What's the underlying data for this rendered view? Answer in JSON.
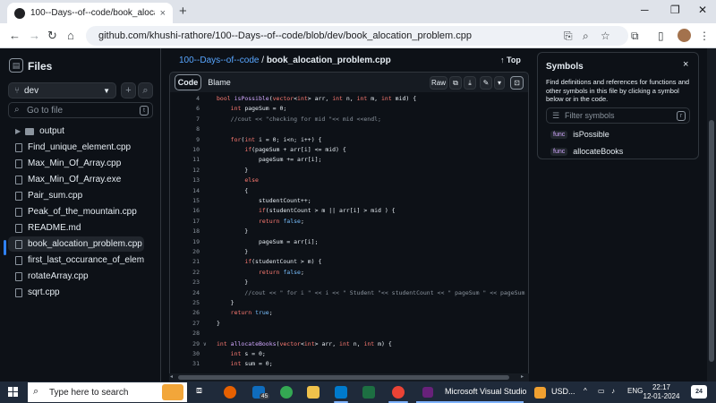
{
  "browser": {
    "tab_title": "100--Days--of--code/book_alocatio",
    "tab_close": "×",
    "new_tab": "+",
    "url": "github.com/khushi-rathore/100--Days--of--code/blob/dev/book_alocation_problem.cpp",
    "window_controls": {
      "minimize": "─",
      "restore": "❐",
      "close": "✕"
    }
  },
  "sidebar": {
    "title": "Files",
    "branch": "dev",
    "add_label": "+",
    "search_btn_label": "⌕",
    "goto_placeholder": "Go to file",
    "goto_key": "t",
    "items": [
      {
        "label": "output",
        "kind": "folder"
      },
      {
        "label": "Find_unique_element.cpp",
        "kind": "file"
      },
      {
        "label": "Max_Min_Of_Array.cpp",
        "kind": "file"
      },
      {
        "label": "Max_Min_Of_Array.exe",
        "kind": "file"
      },
      {
        "label": "Pair_sum.cpp",
        "kind": "file"
      },
      {
        "label": "Peak_of_the_mountain.cpp",
        "kind": "file"
      },
      {
        "label": "README.md",
        "kind": "file"
      },
      {
        "label": "book_alocation_problem.cpp",
        "kind": "file",
        "selected": true
      },
      {
        "label": "first_last_occurance_of_element.c...",
        "kind": "file"
      },
      {
        "label": "rotateArray.cpp",
        "kind": "file"
      },
      {
        "label": "sqrt.cpp",
        "kind": "file"
      }
    ]
  },
  "main": {
    "breadcrumb_repo": "100--Days--of--code",
    "breadcrumb_sep": " / ",
    "breadcrumb_file": "book_alocation_problem.cpp",
    "top_label": "Top",
    "tab_code": "Code",
    "tab_blame": "Blame",
    "raw_label": "Raw",
    "code_lines": [
      {
        "n": "4",
        "fold": false,
        "text": "bool isPossible(vector<int> arr, int n, int m, int mid) {"
      },
      {
        "n": "6",
        "fold": false,
        "text": "    int pageSum = 0;"
      },
      {
        "n": "7",
        "fold": false,
        "text": "    //cout << \"checking for mid \"<< mid <<endl;"
      },
      {
        "n": "8",
        "fold": false,
        "text": ""
      },
      {
        "n": "9",
        "fold": false,
        "text": "    for(int i = 0; i<n; i++) {"
      },
      {
        "n": "10",
        "fold": false,
        "text": "        if(pageSum + arr[i] <= mid) {"
      },
      {
        "n": "11",
        "fold": false,
        "text": "            pageSum += arr[i];"
      },
      {
        "n": "12",
        "fold": false,
        "text": "        }"
      },
      {
        "n": "13",
        "fold": false,
        "text": "        else"
      },
      {
        "n": "14",
        "fold": false,
        "text": "        {"
      },
      {
        "n": "15",
        "fold": false,
        "text": "            studentCount++;"
      },
      {
        "n": "16",
        "fold": false,
        "text": "            if(studentCount > m || arr[i] > mid ) {"
      },
      {
        "n": "17",
        "fold": false,
        "text": "            return false;"
      },
      {
        "n": "18",
        "fold": false,
        "text": "        }"
      },
      {
        "n": "19",
        "fold": false,
        "text": "            pageSum = arr[i];"
      },
      {
        "n": "20",
        "fold": false,
        "text": "        }"
      },
      {
        "n": "21",
        "fold": false,
        "text": "        if(studentCount > m) {"
      },
      {
        "n": "22",
        "fold": false,
        "text": "            return false;"
      },
      {
        "n": "23",
        "fold": false,
        "text": "        }"
      },
      {
        "n": "24",
        "fold": false,
        "text": "        //cout << \" for i \" << i << \" Student \"<< studentCount << \" pageSum \" << pageSum << endl;"
      },
      {
        "n": "25",
        "fold": false,
        "text": "    }"
      },
      {
        "n": "26",
        "fold": false,
        "text": "    return true;"
      },
      {
        "n": "27",
        "fold": false,
        "text": "}"
      },
      {
        "n": "28",
        "fold": false,
        "text": ""
      },
      {
        "n": "29",
        "fold": true,
        "text": "int allocateBooks(vector<int> arr, int n, int m) {"
      },
      {
        "n": "30",
        "fold": false,
        "text": "    int s = 0;"
      },
      {
        "n": "31",
        "fold": false,
        "text": "    int sum = 0;"
      }
    ]
  },
  "symbols": {
    "title": "Symbols",
    "close": "×",
    "description": "Find definitions and references for functions and other symbols in this file by clicking a symbol below or in the code.",
    "filter_placeholder": "Filter symbols",
    "filter_key": "r",
    "items": [
      {
        "badge": "func",
        "name": "isPossible"
      },
      {
        "badge": "func",
        "name": "allocateBooks"
      }
    ]
  },
  "taskbar": {
    "search_placeholder": "Type here to search",
    "mail_badge": "45",
    "active_app": "Microsoft Visual Studio",
    "usd": "USD...",
    "lang": "ENG",
    "time": "22:17",
    "date": "12-01-2024",
    "notifications": "24"
  },
  "colors": {
    "accent": "#2f81f7",
    "link": "#58a6ff",
    "keyword": "#ff7b72",
    "comment": "#8b949e"
  }
}
